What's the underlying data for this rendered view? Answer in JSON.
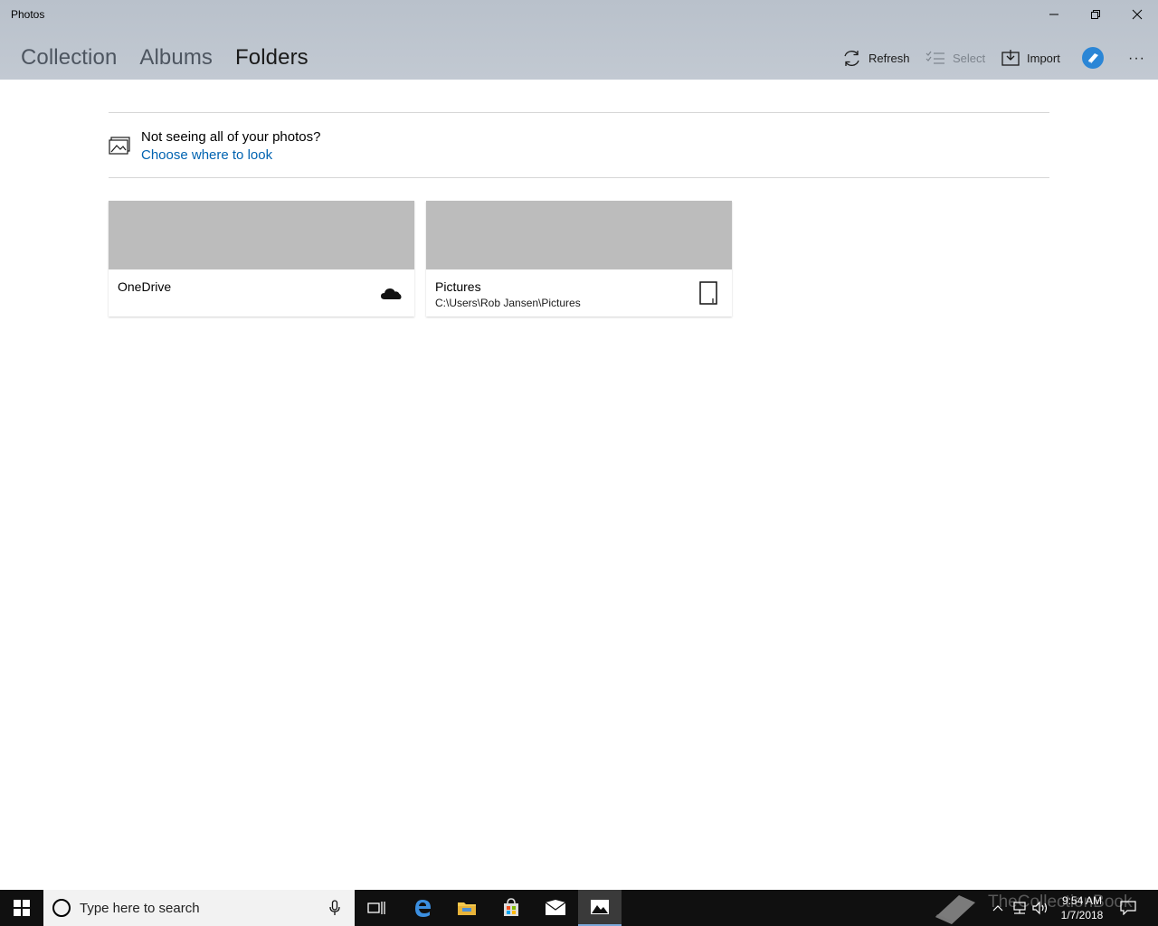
{
  "window": {
    "title": "Photos"
  },
  "tabs": [
    {
      "label": "Collection",
      "active": false
    },
    {
      "label": "Albums",
      "active": false
    },
    {
      "label": "Folders",
      "active": true
    }
  ],
  "commands": {
    "refresh": "Refresh",
    "select": "Select",
    "import": "Import",
    "more": "···"
  },
  "hint": {
    "text": "Not seeing all of your photos?",
    "link": "Choose where to look"
  },
  "folders": [
    {
      "name": "OneDrive",
      "path": "",
      "icon": "cloud-icon"
    },
    {
      "name": "Pictures",
      "path": "C:\\Users\\Rob Jansen\\Pictures",
      "icon": "device-icon"
    }
  ],
  "taskbar": {
    "search_placeholder": "Type here to search",
    "time": "9:54 AM",
    "date": "1/7/2018",
    "watermark": "TheCollectionBook"
  },
  "colors": {
    "header_bg": "#bdc4cd",
    "link": "#0063b1",
    "taskbar": "#101010",
    "thumb": "#bcbcbc"
  }
}
